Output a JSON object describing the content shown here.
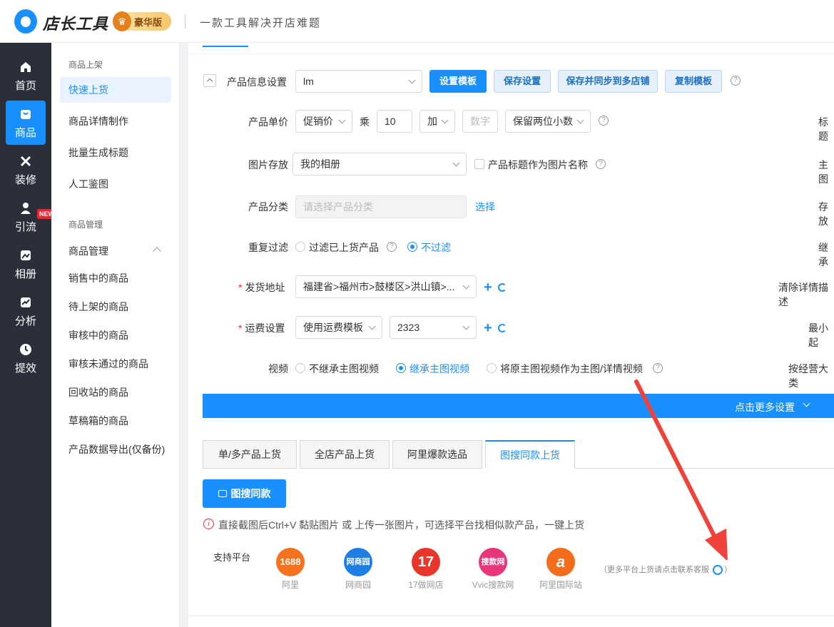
{
  "header": {
    "brand": "店长工具",
    "vip_label": "豪华版",
    "slogan": "一款工具解决开店难题"
  },
  "sidebar": {
    "items": [
      {
        "label": "首页",
        "icon": "home-icon"
      },
      {
        "label": "商品",
        "icon": "bag-icon"
      },
      {
        "label": "装修",
        "icon": "brush-icon"
      },
      {
        "label": "引流",
        "icon": "user-icon"
      },
      {
        "label": "相册",
        "icon": "image-icon"
      },
      {
        "label": "分析",
        "icon": "chart-icon"
      },
      {
        "label": "提效",
        "icon": "clock-icon"
      }
    ],
    "new_badge": "NEW"
  },
  "subnav": {
    "group1": "商品上架",
    "group1_items": [
      "快速上货",
      "商品详情制作",
      "批量生成标题",
      "人工鉴图"
    ],
    "group2": "商品管理",
    "group2_title": "商品管理",
    "group2_items": [
      "销售中的商品",
      "待上架的商品",
      "审核中的商品",
      "审核未通过的商品",
      "回收站的商品",
      "草稿箱的商品",
      "产品数据导出(仅备份)"
    ]
  },
  "form": {
    "product_info": {
      "label": "产品信息设置",
      "value": "lm",
      "buttons": [
        "设置模板",
        "保存设置",
        "保存并同步到多店铺",
        "复制模板"
      ]
    },
    "price": {
      "label": "产品单价",
      "base": "促销价",
      "multiply_label": "乘",
      "multiplier": "10",
      "op": "加",
      "number_placeholder": "数字",
      "rounding": "保留两位小数"
    },
    "image_storage": {
      "label": "图片存放",
      "value": "我的相册",
      "checkbox_label": "产品标题作为图片名称"
    },
    "category": {
      "label": "产品分类",
      "placeholder": "请选择产品分类",
      "select_link": "选择"
    },
    "dup_filter": {
      "label": "重复过滤",
      "opt1": "过滤已上货产品",
      "opt2": "不过滤"
    },
    "ship_addr": {
      "label": "发货地址",
      "value": "福建省>福州市>鼓楼区>洪山镇>..."
    },
    "freight": {
      "label": "运费设置",
      "mode": "使用运费模板",
      "template": "2323"
    },
    "video": {
      "label": "视频",
      "opt1": "不继承主图视频",
      "opt2": "继承主图视频",
      "opt3": "将原主图视频作为主图/详情视频"
    },
    "right_labels": [
      "标题",
      "主图",
      "存放",
      "继承",
      "清除详情描述",
      "最小起",
      "按经营大类"
    ],
    "more_settings": "点击更多设置"
  },
  "tabs": [
    "单/多产品上货",
    "全店产品上货",
    "阿里爆款选品",
    "图搜同款上货"
  ],
  "image_search": {
    "button": "图搜同款",
    "hint": "直接截图后Ctrl+V 黏贴图片 或 上传一张图片，可选择平台找相似款产品，一键上货",
    "platforms_label": "支持平台",
    "platforms": [
      {
        "logo": "1688",
        "name": "阿里",
        "color": "#f5731f"
      },
      {
        "logo": "网商园",
        "name": "网商园",
        "color": "#1f7ee3"
      },
      {
        "logo": "17",
        "name": "17做网店",
        "color": "#e8362b"
      },
      {
        "logo": "搜款网",
        "name": "Vvic搜款网",
        "color": "#e9357b"
      },
      {
        "logo": "a",
        "name": "阿里国际站",
        "color": "#f36c1a"
      }
    ],
    "more_note": "（更多平台上货请点击联系客服",
    "more_note_end": "）"
  },
  "colors": {
    "accent": "#1890ff",
    "sidebar_bg": "#2b2f3a",
    "arrow": "#f0413a"
  }
}
